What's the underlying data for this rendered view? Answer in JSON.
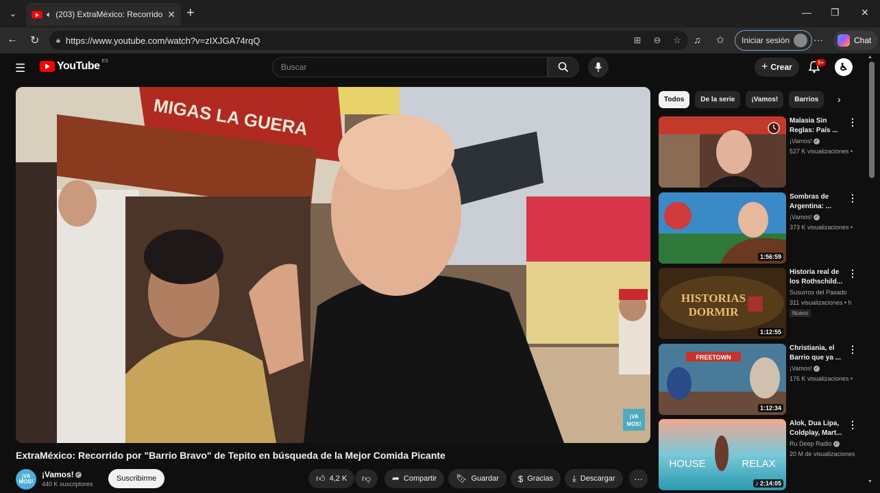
{
  "browser": {
    "tab_title": "(203) ExtraMéxico: Recorrido p",
    "url": "https://www.youtube.com/watch?v=zIXJGA74rqQ",
    "signin_label": "Iniciar sesión",
    "chat_label": "Chat"
  },
  "youtube": {
    "logo_text": "YouTube",
    "country_code": "ES",
    "search_placeholder": "Buscar",
    "create_label": "Crear",
    "notif_badge": "9+"
  },
  "video": {
    "title": "ExtraMéxico: Recorrido por \"Barrio Bravo\" de Tepito en búsqueda de la Mejor Comida Picante",
    "channel_name": "¡Vamos!",
    "channel_avatar_text": "¡VA\nMOS!",
    "subscribers": "440 K suscriptores",
    "subscribe_label": "Suscribirme",
    "likes": "4,2 K",
    "share_label": "Compartir",
    "save_label": "Guardar",
    "thanks_label": "Gracias",
    "download_label": "Descargar",
    "sign_text": "MIGAS LA GUERA",
    "watermark": "¡VA MOS!"
  },
  "chips": [
    "Todos",
    "De la serie",
    "¡Vamos!",
    "Barrios"
  ],
  "recommendations": [
    {
      "title": "Malasia Sin Reglas: País ...",
      "channel": "¡Vamos!",
      "verified": true,
      "views": "527 K visualizaciones •",
      "duration": "",
      "new": ""
    },
    {
      "title": "Sombras de Argentina: ...",
      "channel": "¡Vamos!",
      "verified": true,
      "views": "373 K visualizaciones •",
      "duration": "1:56:59",
      "new": ""
    },
    {
      "title": "Historia real de los Rothschild...",
      "channel": "Susurros del Pasado",
      "verified": false,
      "views": "311 visualizaciones • h",
      "duration": "1:12:55",
      "new": "Nuevo",
      "thumb_text": "HISTORIAS DORMIR"
    },
    {
      "title": "Christiania, el Barrio que ya ...",
      "channel": "¡Vamos!",
      "verified": true,
      "views": "176 K visualizaciones •",
      "duration": "1:12:34",
      "new": "",
      "thumb_text": "FREETOWN"
    },
    {
      "title": "Alok, Dua Lipa, Coldplay, Mart...",
      "channel": "Ru Deep Radio",
      "verified": true,
      "views": "20 M de visualizaciones",
      "duration": "♪ 2:14:05",
      "new": "",
      "thumb_text": "HOUSE RELAX"
    }
  ]
}
